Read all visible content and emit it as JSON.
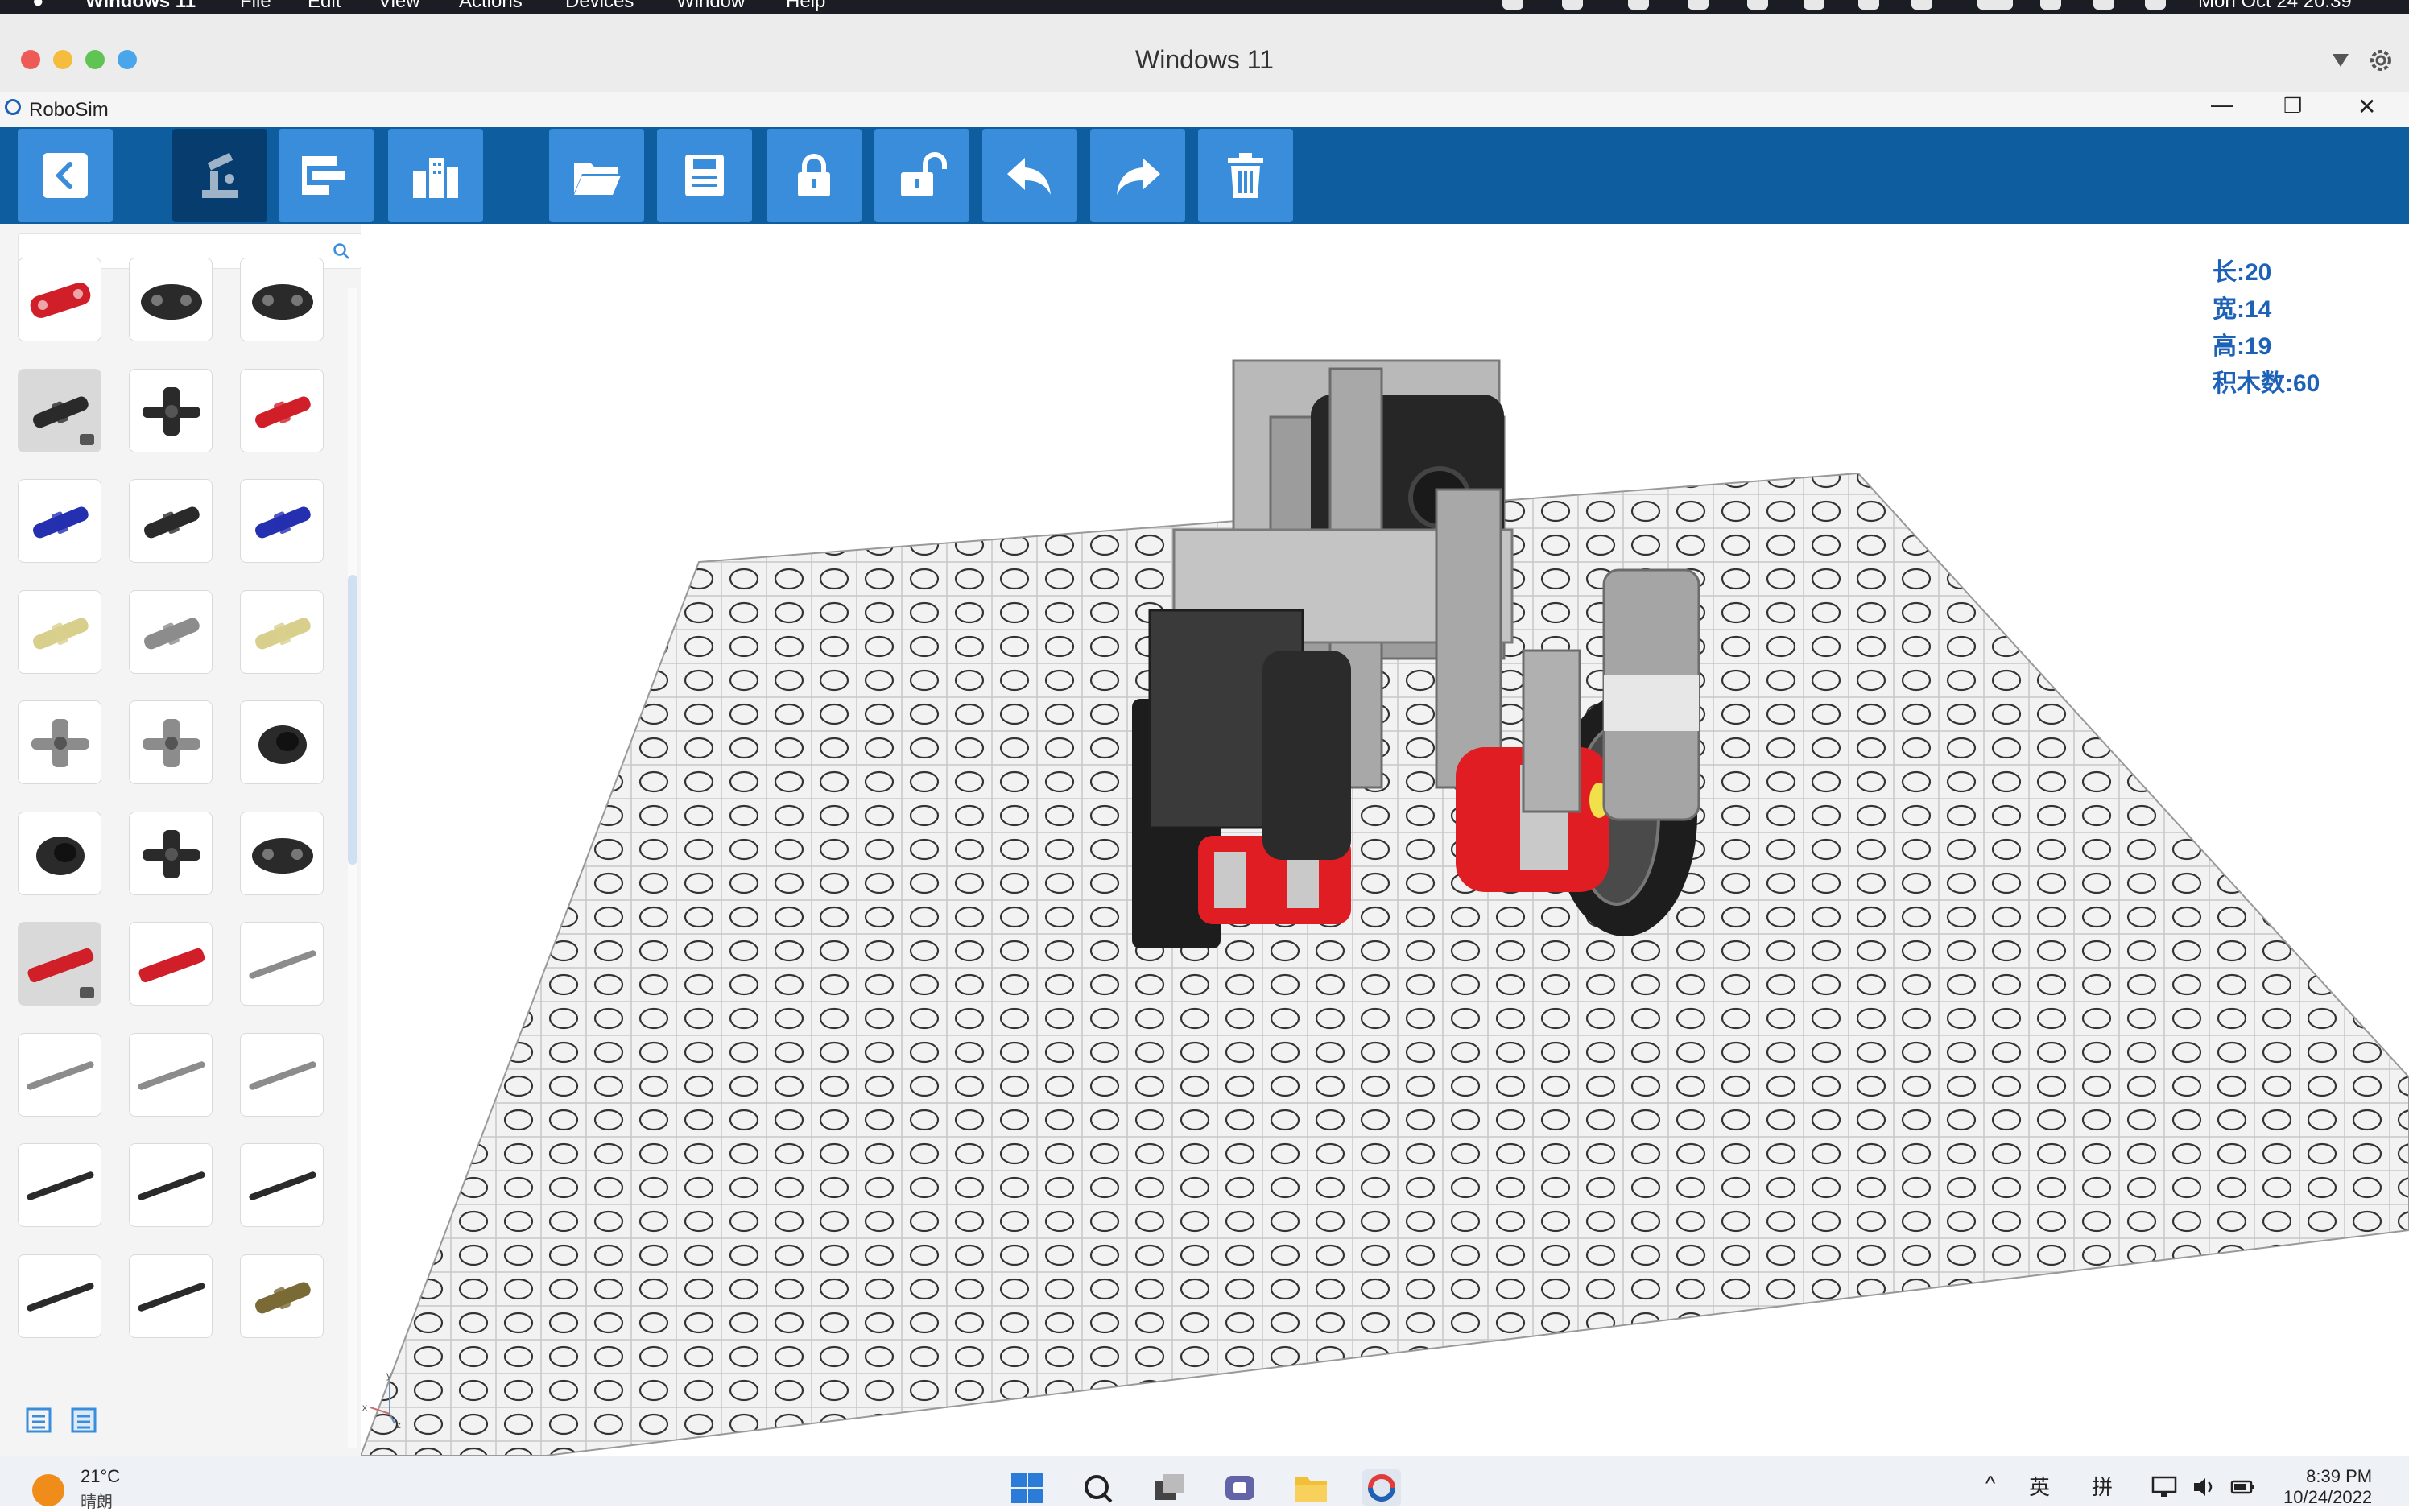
{
  "mac_menu": {
    "app_name": "Windows 11",
    "items": [
      "File",
      "Edit",
      "View",
      "Actions",
      "Devices",
      "Window",
      "Help"
    ],
    "clock": "Mon Oct 24  20:39"
  },
  "window_title": "Windows 11",
  "app": {
    "title": "RoboSim"
  },
  "toolbar": {
    "buttons": [
      {
        "icon": "back-arrow-icon"
      },
      {
        "icon": "robot-arm-icon",
        "active": true
      },
      {
        "icon": "blocks-program-icon"
      },
      {
        "icon": "city-scene-icon"
      },
      {
        "icon": "folder-open-icon"
      },
      {
        "icon": "save-icon"
      },
      {
        "icon": "lock-icon"
      },
      {
        "icon": "unlock-icon"
      },
      {
        "icon": "undo-icon"
      },
      {
        "icon": "redo-icon"
      },
      {
        "icon": "trash-icon"
      }
    ]
  },
  "search": {
    "placeholder": ""
  },
  "stats": {
    "length": "长:20",
    "width": "宽:14",
    "height": "高:19",
    "block_count": "积木数:60"
  },
  "axes": {
    "x": "x",
    "y": "y",
    "z": "z"
  },
  "colors": {
    "toolbar_bg": "#0d5d9f",
    "button_bg": "#3a8ddb",
    "stats_text": "#1d62b6",
    "part_red": "#d11f2a",
    "part_black": "#2a2a2a",
    "part_blue": "#2430b0",
    "part_tan": "#d8cf8c",
    "part_gray": "#8c8c8c"
  },
  "taskbar": {
    "temperature": "21°C",
    "weather": "晴朗",
    "ime_1": "英",
    "ime_2": "拼",
    "time": "8:39 PM",
    "date": "10/24/2022"
  }
}
